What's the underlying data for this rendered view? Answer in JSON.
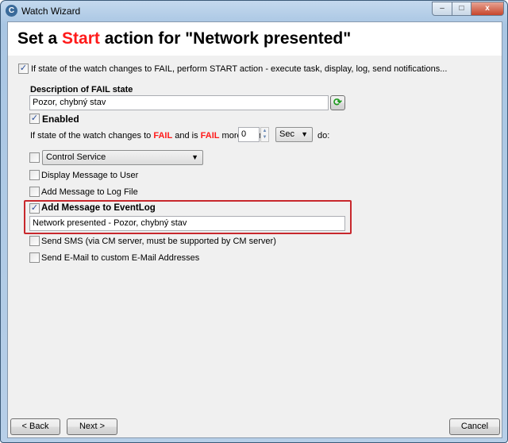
{
  "window": {
    "title": "Watch Wizard",
    "minimize": "–",
    "maximize": "□",
    "close": "x"
  },
  "header": {
    "title_pre": "Set a ",
    "title_accent": "Start",
    "title_post": " action for \"Network presented\"",
    "accent_color": "#ff1a1a"
  },
  "main_option": {
    "checked": true,
    "label": "If state of the watch changes to FAIL, perform START action - execute task, display, log, send notifications..."
  },
  "description": {
    "label": "Description of FAIL state",
    "value": "Pozor, chybný stav",
    "refresh_icon": "refresh-icon"
  },
  "enabled": {
    "checked": true,
    "label": "Enabled"
  },
  "condition": {
    "part1": "If state of the watch changes to ",
    "fail1": "FAIL",
    "part2": " and is ",
    "fail2": "FAIL",
    "part3": " more than",
    "value": "0",
    "unit": "Sec",
    "do": "do:"
  },
  "actions": [
    {
      "label": "Control Service",
      "checked": false
    },
    {
      "label": "Display Message to User",
      "checked": false
    },
    {
      "label": "Add Message to Log File",
      "checked": false
    },
    {
      "label": "Add Message to EventLog",
      "checked": true,
      "value": "Network presented - Pozor, chybný stav"
    },
    {
      "label": "Send SMS (via CM server, must be supported by CM server)",
      "checked": false
    },
    {
      "label": "Send E-Mail to custom E-Mail Addresses",
      "checked": false
    }
  ],
  "buttons": {
    "back": "< Back",
    "next": "Next >",
    "cancel": "Cancel"
  }
}
